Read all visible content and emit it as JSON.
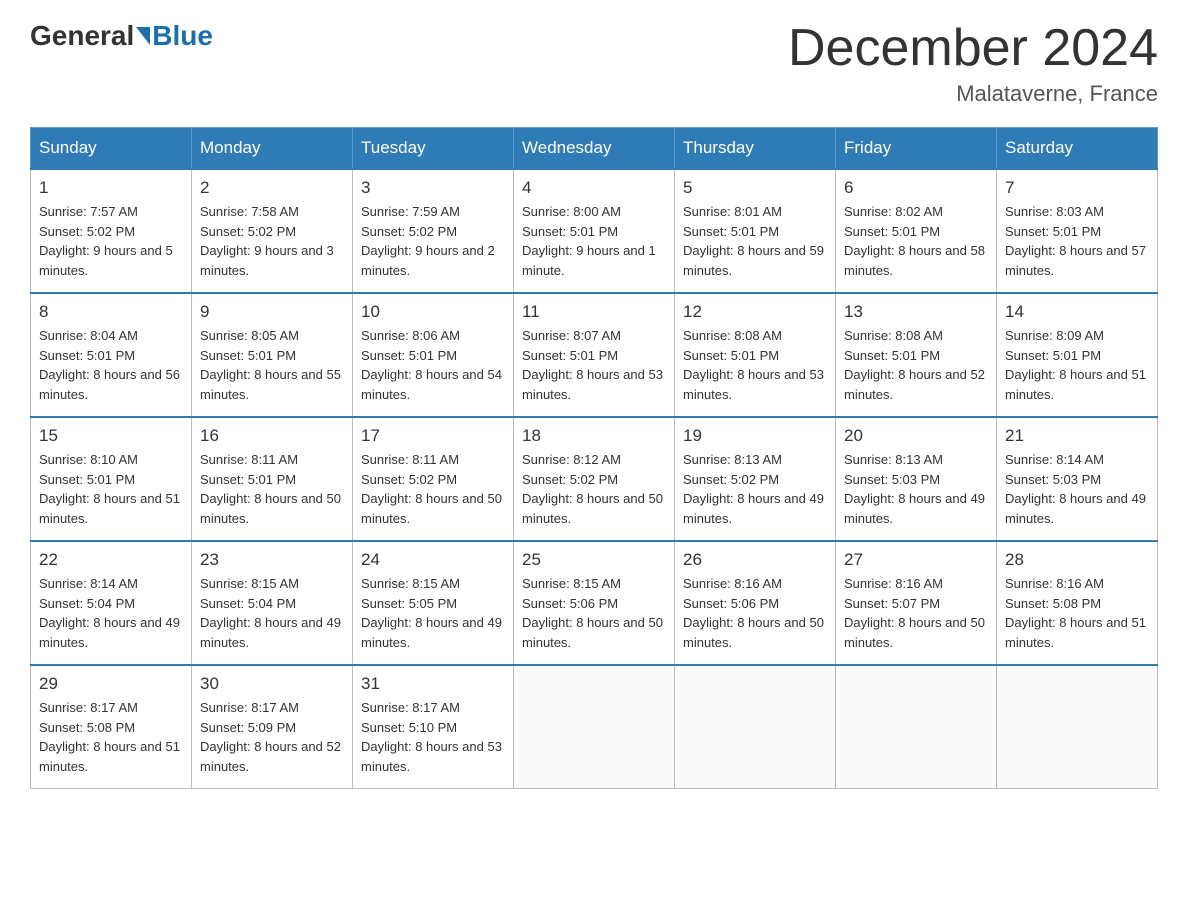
{
  "header": {
    "logo_general": "General",
    "logo_blue": "Blue",
    "month_title": "December 2024",
    "location": "Malataverne, France"
  },
  "days_of_week": [
    "Sunday",
    "Monday",
    "Tuesday",
    "Wednesday",
    "Thursday",
    "Friday",
    "Saturday"
  ],
  "weeks": [
    [
      {
        "day": "1",
        "sunrise": "7:57 AM",
        "sunset": "5:02 PM",
        "daylight": "9 hours and 5 minutes."
      },
      {
        "day": "2",
        "sunrise": "7:58 AM",
        "sunset": "5:02 PM",
        "daylight": "9 hours and 3 minutes."
      },
      {
        "day": "3",
        "sunrise": "7:59 AM",
        "sunset": "5:02 PM",
        "daylight": "9 hours and 2 minutes."
      },
      {
        "day": "4",
        "sunrise": "8:00 AM",
        "sunset": "5:01 PM",
        "daylight": "9 hours and 1 minute."
      },
      {
        "day": "5",
        "sunrise": "8:01 AM",
        "sunset": "5:01 PM",
        "daylight": "8 hours and 59 minutes."
      },
      {
        "day": "6",
        "sunrise": "8:02 AM",
        "sunset": "5:01 PM",
        "daylight": "8 hours and 58 minutes."
      },
      {
        "day": "7",
        "sunrise": "8:03 AM",
        "sunset": "5:01 PM",
        "daylight": "8 hours and 57 minutes."
      }
    ],
    [
      {
        "day": "8",
        "sunrise": "8:04 AM",
        "sunset": "5:01 PM",
        "daylight": "8 hours and 56 minutes."
      },
      {
        "day": "9",
        "sunrise": "8:05 AM",
        "sunset": "5:01 PM",
        "daylight": "8 hours and 55 minutes."
      },
      {
        "day": "10",
        "sunrise": "8:06 AM",
        "sunset": "5:01 PM",
        "daylight": "8 hours and 54 minutes."
      },
      {
        "day": "11",
        "sunrise": "8:07 AM",
        "sunset": "5:01 PM",
        "daylight": "8 hours and 53 minutes."
      },
      {
        "day": "12",
        "sunrise": "8:08 AM",
        "sunset": "5:01 PM",
        "daylight": "8 hours and 53 minutes."
      },
      {
        "day": "13",
        "sunrise": "8:08 AM",
        "sunset": "5:01 PM",
        "daylight": "8 hours and 52 minutes."
      },
      {
        "day": "14",
        "sunrise": "8:09 AM",
        "sunset": "5:01 PM",
        "daylight": "8 hours and 51 minutes."
      }
    ],
    [
      {
        "day": "15",
        "sunrise": "8:10 AM",
        "sunset": "5:01 PM",
        "daylight": "8 hours and 51 minutes."
      },
      {
        "day": "16",
        "sunrise": "8:11 AM",
        "sunset": "5:01 PM",
        "daylight": "8 hours and 50 minutes."
      },
      {
        "day": "17",
        "sunrise": "8:11 AM",
        "sunset": "5:02 PM",
        "daylight": "8 hours and 50 minutes."
      },
      {
        "day": "18",
        "sunrise": "8:12 AM",
        "sunset": "5:02 PM",
        "daylight": "8 hours and 50 minutes."
      },
      {
        "day": "19",
        "sunrise": "8:13 AM",
        "sunset": "5:02 PM",
        "daylight": "8 hours and 49 minutes."
      },
      {
        "day": "20",
        "sunrise": "8:13 AM",
        "sunset": "5:03 PM",
        "daylight": "8 hours and 49 minutes."
      },
      {
        "day": "21",
        "sunrise": "8:14 AM",
        "sunset": "5:03 PM",
        "daylight": "8 hours and 49 minutes."
      }
    ],
    [
      {
        "day": "22",
        "sunrise": "8:14 AM",
        "sunset": "5:04 PM",
        "daylight": "8 hours and 49 minutes."
      },
      {
        "day": "23",
        "sunrise": "8:15 AM",
        "sunset": "5:04 PM",
        "daylight": "8 hours and 49 minutes."
      },
      {
        "day": "24",
        "sunrise": "8:15 AM",
        "sunset": "5:05 PM",
        "daylight": "8 hours and 49 minutes."
      },
      {
        "day": "25",
        "sunrise": "8:15 AM",
        "sunset": "5:06 PM",
        "daylight": "8 hours and 50 minutes."
      },
      {
        "day": "26",
        "sunrise": "8:16 AM",
        "sunset": "5:06 PM",
        "daylight": "8 hours and 50 minutes."
      },
      {
        "day": "27",
        "sunrise": "8:16 AM",
        "sunset": "5:07 PM",
        "daylight": "8 hours and 50 minutes."
      },
      {
        "day": "28",
        "sunrise": "8:16 AM",
        "sunset": "5:08 PM",
        "daylight": "8 hours and 51 minutes."
      }
    ],
    [
      {
        "day": "29",
        "sunrise": "8:17 AM",
        "sunset": "5:08 PM",
        "daylight": "8 hours and 51 minutes."
      },
      {
        "day": "30",
        "sunrise": "8:17 AM",
        "sunset": "5:09 PM",
        "daylight": "8 hours and 52 minutes."
      },
      {
        "day": "31",
        "sunrise": "8:17 AM",
        "sunset": "5:10 PM",
        "daylight": "8 hours and 53 minutes."
      },
      null,
      null,
      null,
      null
    ]
  ]
}
